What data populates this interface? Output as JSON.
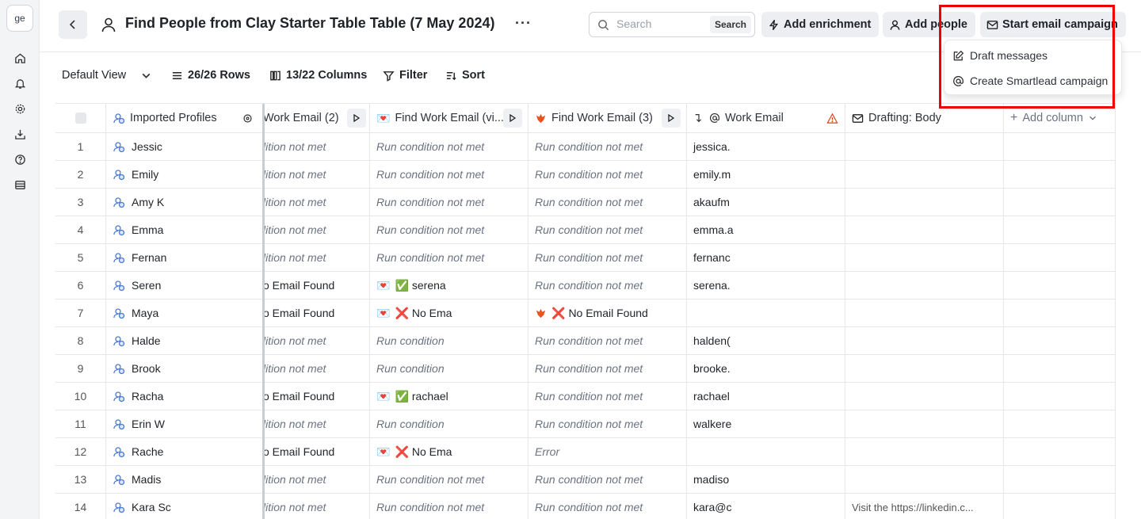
{
  "workspace": {
    "initials": "ge"
  },
  "sidebar": {
    "icons": [
      "home-icon",
      "bell-icon",
      "gear-icon",
      "download-icon",
      "help-icon",
      "table-icon"
    ]
  },
  "header": {
    "title": "Find People from Clay Starter Table Table (7 May 2024)",
    "more_label": "···",
    "search_placeholder": "Search",
    "search_button": "Search",
    "add_enrichment": "Add enrichment",
    "add_people": "Add people",
    "start_email_campaign": "Start email campaign"
  },
  "campaign_menu": {
    "items": [
      {
        "label": "Draft messages",
        "icon": "edit-icon"
      },
      {
        "label": "Create Smartlead campaign",
        "icon": "at-icon"
      }
    ]
  },
  "toolbar": {
    "view": "Default View",
    "rows": "26/26 Rows",
    "columns": "13/22 Columns",
    "filter": "Filter",
    "sort": "Sort"
  },
  "columns": {
    "profiles": "Imported Profiles",
    "email2": "Work Email (2)",
    "email_vi": "Find Work Email (vi...",
    "email3": "Find Work Email (3)",
    "work_email": "Work Email",
    "drafting": "Drafting: Body",
    "add_column": "Add column"
  },
  "rows": [
    {
      "n": "1",
      "name": "Jessic",
      "c2": "lition not met",
      "c3": "Run condition not met",
      "c4": "Run condition not met",
      "we": "jessica.",
      "dr": ""
    },
    {
      "n": "2",
      "name": "Emily",
      "c2": "lition not met",
      "c3": "Run condition not met",
      "c4": "Run condition not met",
      "we": "emily.m",
      "dr": ""
    },
    {
      "n": "3",
      "name": "Amy K",
      "c2": "lition not met",
      "c3": "Run condition not met",
      "c4": "Run condition not met",
      "we": "akaufm",
      "dr": ""
    },
    {
      "n": "4",
      "name": "Emma",
      "c2": "lition not met",
      "c3": "Run condition not met",
      "c4": "Run condition not met",
      "we": "emma.a",
      "dr": ""
    },
    {
      "n": "5",
      "name": "Fernan",
      "c2": "lition not met",
      "c3": "Run condition not met",
      "c4": "Run condition not met",
      "we": "fernanc",
      "dr": ""
    },
    {
      "n": "6",
      "name": "Seren",
      "c2": "o Email Found",
      "c3": "serena",
      "c3s": "ok",
      "c4": "Run condition not met",
      "we": "serena.",
      "dr": ""
    },
    {
      "n": "7",
      "name": "Maya",
      "c2": "o Email Found",
      "c3": "No Ema",
      "c3s": "err",
      "c4": "No Email Found",
      "c4s": "err",
      "we": "",
      "dr": ""
    },
    {
      "n": "8",
      "name": "Halde",
      "c2": "lition not met",
      "c3": "Run condition",
      "c4": "Run condition not met",
      "we": "halden(",
      "dr": ""
    },
    {
      "n": "9",
      "name": "Brook",
      "c2": "lition not met",
      "c3": "Run condition",
      "c4": "Run condition not met",
      "we": "brooke.",
      "dr": ""
    },
    {
      "n": "10",
      "name": "Racha",
      "c2": "o Email Found",
      "c3": "rachael",
      "c3s": "ok",
      "c4": "Run condition not met",
      "we": "rachael",
      "dr": ""
    },
    {
      "n": "11",
      "name": "Erin W",
      "c2": "lition not met",
      "c3": "Run condition",
      "c4": "Run condition not met",
      "we": "walkere",
      "dr": ""
    },
    {
      "n": "12",
      "name": "Rache",
      "c2": "o Email Found",
      "c3": "No Ema",
      "c3s": "err",
      "c4": "Error",
      "we": "",
      "dr": ""
    },
    {
      "n": "13",
      "name": "Madis",
      "c2": "lition not met",
      "c3": "Run condition not met",
      "c4": "Run condition not met",
      "we": "madiso",
      "dr": ""
    },
    {
      "n": "14",
      "name": "Kara Sc",
      "c2": "lition not met",
      "c3": "Run condition not met",
      "c4": "Run condition not met",
      "we": "kara@c",
      "dr": "Visit the https://linkedin.c..."
    }
  ]
}
